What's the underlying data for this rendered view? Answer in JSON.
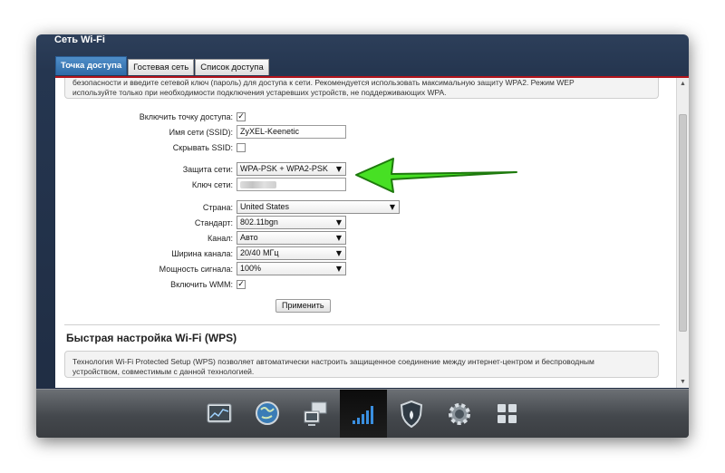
{
  "window": {
    "title": "Сеть Wi-Fi"
  },
  "tabs": [
    {
      "label": "Точка доступа",
      "active": true
    },
    {
      "label": "Гостевая сеть",
      "active": false
    },
    {
      "label": "Список доступа",
      "active": false
    }
  ],
  "notice": {
    "line1": "безопасности и введите сетевой ключ (пароль) для доступа к сети. Рекомендуется использовать максимальную защиту WPA2. Режим WEP",
    "line2": "используйте только при необходимости подключения устаревших устройств, не поддерживающих WPA."
  },
  "form": {
    "enable_ap": {
      "label": "Включить точку доступа:",
      "checked": "✓"
    },
    "ssid": {
      "label": "Имя сети (SSID):",
      "value": "ZyXEL-Keenetic"
    },
    "hide_ssid": {
      "label": "Скрывать SSID:",
      "checked": ""
    },
    "security": {
      "label": "Защита сети:",
      "value": "WPA-PSK + WPA2-PSK"
    },
    "key": {
      "label": "Ключ сети:"
    },
    "country": {
      "label": "Страна:",
      "value": "United States"
    },
    "standard": {
      "label": "Стандарт:",
      "value": "802.11bgn"
    },
    "channel": {
      "label": "Канал:",
      "value": "Авто"
    },
    "width": {
      "label": "Ширина канала:",
      "value": "20/40 МГц"
    },
    "power": {
      "label": "Мощность сигнала:",
      "value": "100%"
    },
    "wmm": {
      "label": "Включить WMM:",
      "checked": "✓"
    },
    "apply_label": "Применить"
  },
  "wps": {
    "title": "Быстрая настройка Wi-Fi (WPS)",
    "line1": "Технология Wi-Fi Protected Setup (WPS) позволяет автоматически настроить защищенное соединение между интернет-центром и беспроводным",
    "line2": "устройством, совместимым с данной технологией."
  },
  "dock": {
    "items": [
      {
        "icon": "monitor-chart-icon",
        "active": false
      },
      {
        "icon": "globe-icon",
        "active": false
      },
      {
        "icon": "network-computers-icon",
        "active": false
      },
      {
        "icon": "wifi-signal-bars-icon",
        "active": true
      },
      {
        "icon": "shield-icon",
        "active": false
      },
      {
        "icon": "gear-icon",
        "active": false
      },
      {
        "icon": "apps-grid-icon",
        "active": false
      }
    ]
  },
  "colors": {
    "tab_active": "#3a7bbd",
    "accent_line": "#b3141b",
    "arrow": "#44dd22"
  }
}
